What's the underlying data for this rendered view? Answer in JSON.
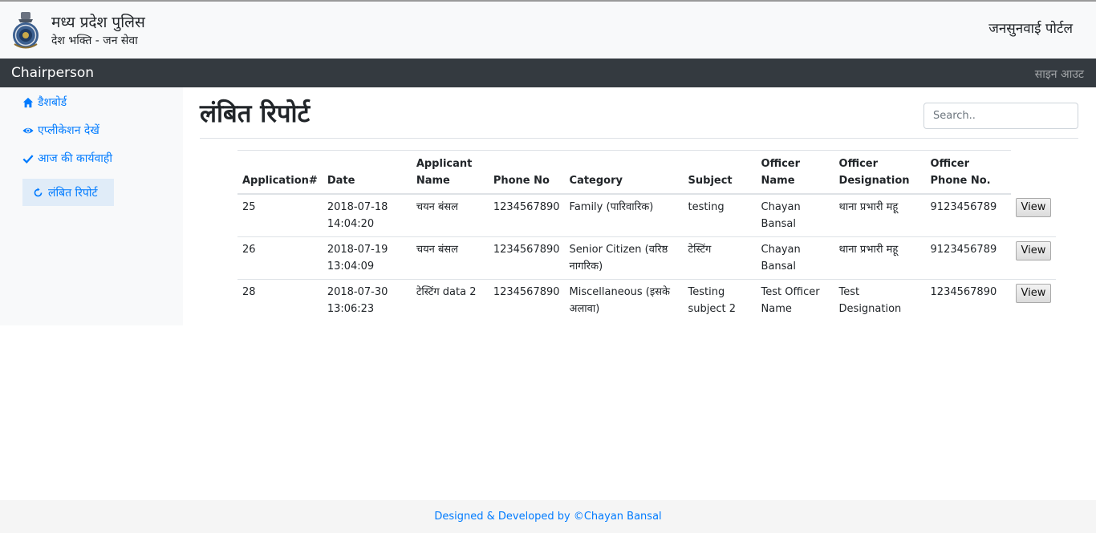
{
  "header": {
    "title": "मध्य प्रदेश पुलिस",
    "subtitle": "देश भक्ति - जन सेवा",
    "portal_name": "जनसुनवाई पोर्टल"
  },
  "topbar": {
    "role": "Chairperson",
    "signout_label": "साइन आउट"
  },
  "sidebar": {
    "items": [
      {
        "label": "डैशबोर्ड",
        "icon": "home-icon"
      },
      {
        "label": "एप्लीकेशन देखें",
        "icon": "eye-icon"
      },
      {
        "label": "आज की कार्यवाही",
        "icon": "check-icon"
      },
      {
        "label": "लंबित रिपोर्ट",
        "icon": "refresh-icon",
        "active": true
      }
    ]
  },
  "main": {
    "title": "लंबित रिपोर्ट",
    "search_placeholder": "Search..",
    "table": {
      "headers": [
        "Application#",
        "Date",
        "Applicant Name",
        "Phone No",
        "Category",
        "Subject",
        "Officer Name",
        "Officer Designation",
        "Officer Phone No."
      ],
      "rows": [
        [
          "25",
          "2018-07-18 14:04:20",
          "चयन बंसल",
          "1234567890",
          "Family (पारिवारिक)",
          "testing",
          "Chayan Bansal",
          "थाना प्रभारी महू",
          "9123456789"
        ],
        [
          "26",
          "2018-07-19 13:04:09",
          "चयन बंसल",
          "1234567890",
          "Senior Citizen (वरिष्ठ नागरिक)",
          "टेस्टिंग",
          "Chayan Bansal",
          "थाना प्रभारी महू",
          "9123456789"
        ],
        [
          "28",
          "2018-07-30 13:06:23",
          "टेस्टिंग data 2",
          "1234567890",
          "Miscellaneous (इसके अलावा)",
          "Testing subject 2",
          "Test Officer Name",
          "Test Designation",
          "1234567890"
        ]
      ],
      "view_label": "View"
    }
  },
  "footer": {
    "text": "Designed & Developed by ©Chayan Bansal"
  },
  "colors": {
    "link": "#007bff",
    "navbar": "#343a40",
    "header_bg": "#f8f9fa",
    "sidebar_active": "#e0ecf8"
  }
}
